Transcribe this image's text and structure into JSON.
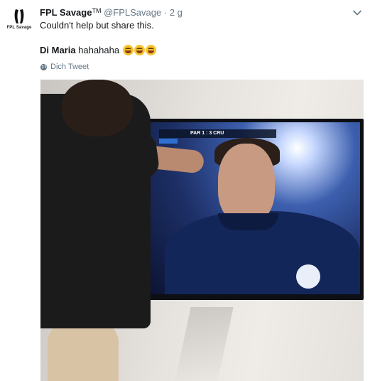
{
  "author": {
    "name": "FPL Savage",
    "tm": "TM",
    "handle": "@FPLSavage",
    "separator": "·",
    "time": "2 g",
    "avatar_text": "FPL Savage"
  },
  "tweet": {
    "line1": "Couldn't help but share this.",
    "line2_bold": "Di Maria",
    "line2_rest": "hahahaha",
    "emoji_count": 3
  },
  "translate": {
    "label": "Dịch Tweet"
  },
  "media": {
    "scoreboard": "PAR  1 : 3  CRU"
  },
  "icons": {
    "menu": "chevron-down-icon",
    "translate": "globe-icon"
  },
  "colors": {
    "text": "#14171a",
    "muted": "#657786"
  }
}
